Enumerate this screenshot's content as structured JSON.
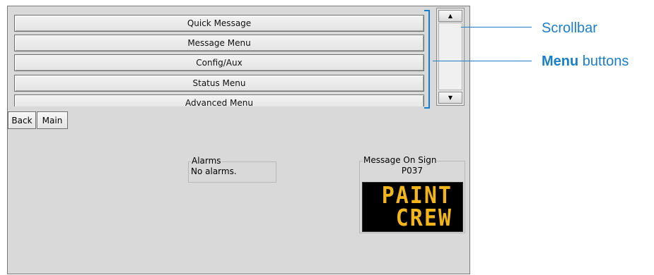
{
  "menu": {
    "items": [
      {
        "label": "Quick Message"
      },
      {
        "label": "Message Menu"
      },
      {
        "label": "Config/Aux"
      },
      {
        "label": "Status Menu"
      },
      {
        "label": "Advanced Menu"
      }
    ]
  },
  "nav": {
    "back_label": "Back",
    "main_label": "Main"
  },
  "alarms": {
    "title": "Alarms",
    "text": "No alarms."
  },
  "sign": {
    "title": "Message On Sign",
    "id": "P037",
    "lines": [
      "PAINT",
      "CREW"
    ],
    "text_color": "#f2b51a",
    "background_color": "#000000"
  },
  "callouts": {
    "scrollbar_label": "Scrollbar",
    "menu_bold": "Menu",
    "menu_rest": " buttons",
    "color": "#1a7fc9"
  },
  "icons": {
    "scroll_up": "triangle-up-icon",
    "scroll_down": "triangle-down-icon"
  }
}
